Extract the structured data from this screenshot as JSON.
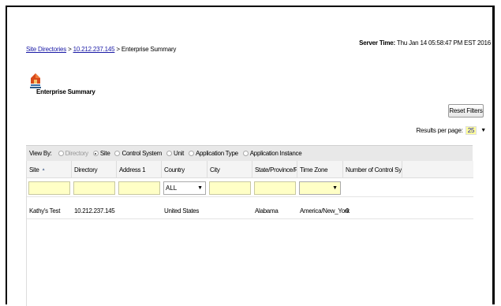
{
  "breadcrumb": {
    "root": "Site Directories",
    "sep1": " > ",
    "ip": "10.212.237.145",
    "sep2": " > ",
    "current": "Enterprise Summary"
  },
  "server_time": {
    "label": "Server Time:",
    "value": "Thu Jan 14 05:58:47 PM EST 2016"
  },
  "page": {
    "title": "Enterprise Summary",
    "icon": "enterprise-house-icon"
  },
  "toolbar": {
    "reset_filters": "Reset Filters",
    "results_per_page_label": "Results per page:",
    "results_per_page_value": "25"
  },
  "view_by": {
    "label": "View By:",
    "options": [
      {
        "label": "Directory",
        "selected": false,
        "disabled": true
      },
      {
        "label": "Site",
        "selected": true,
        "disabled": false
      },
      {
        "label": "Control System",
        "selected": false,
        "disabled": false
      },
      {
        "label": "Unit",
        "selected": false,
        "disabled": false
      },
      {
        "label": "Application Type",
        "selected": false,
        "disabled": false
      },
      {
        "label": "Application Instance",
        "selected": false,
        "disabled": false
      }
    ]
  },
  "table": {
    "columns": [
      "Site",
      "Directory",
      "Address 1",
      "Country",
      "City",
      "State/Province/Region",
      "Time Zone",
      "Number of Control Syst..."
    ],
    "filters": {
      "country": "ALL",
      "time_zone": ""
    },
    "rows": [
      [
        "Kathy's Test",
        "10.212.237.145",
        "",
        "United States",
        "",
        "Alabama",
        "America/New_York",
        "0"
      ]
    ]
  },
  "colors": {
    "link": "#1a1aa6",
    "filter_bg": "#ffffc6",
    "viewby_bg": "#e8e8e8"
  }
}
